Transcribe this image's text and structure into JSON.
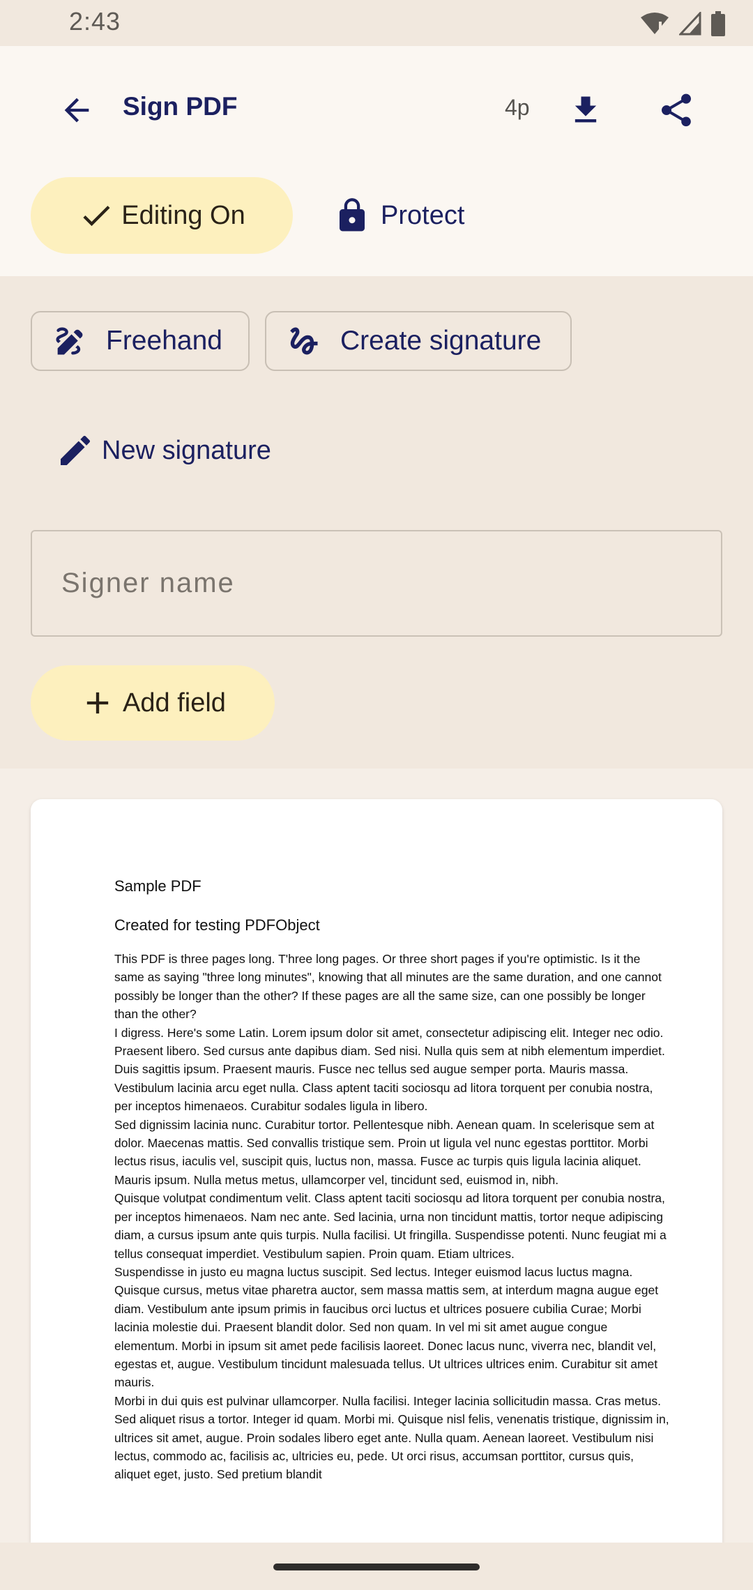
{
  "status_bar": {
    "time": "2:43"
  },
  "app_bar": {
    "title": "Sign PDF",
    "page_count": "4p",
    "icons": [
      "arrow-back-icon",
      "download-icon",
      "share-icon"
    ]
  },
  "mode_chips": {
    "editing_label": "Editing On",
    "protect_label": "Protect"
  },
  "signature_tools": {
    "freehand_label": "Freehand",
    "create_signature_label": "Create signature",
    "new_signature_label": "New signature"
  },
  "signer": {
    "placeholder": "Signer name",
    "value": ""
  },
  "add_field_label": "Add field",
  "pdf": {
    "title": "Sample PDF",
    "subtitle": "Created for testing PDFObject",
    "paragraphs": [
      "This PDF is three pages long. T'hree long pages. Or three short pages if you're optimistic. Is it the same as saying \"three long minutes\", knowing that all minutes are the same duration, and one cannot possibly be longer than the other? If these pages are all the same size, can one possibly be longer than the other?",
      "I digress. Here's some Latin. Lorem ipsum dolor sit amet, consectetur adipiscing elit. Integer nec odio. Praesent libero. Sed cursus ante dapibus diam. Sed nisi. Nulla quis sem at nibh elementum imperdiet. Duis sagittis ipsum. Praesent mauris. Fusce nec tellus sed augue semper porta. Mauris massa. Vestibulum lacinia arcu eget nulla. Class aptent taciti sociosqu ad litora torquent per conubia nostra, per inceptos himenaeos. Curabitur sodales ligula in libero.",
      "Sed dignissim lacinia nunc. Curabitur tortor. Pellentesque nibh. Aenean quam. In scelerisque sem at dolor. Maecenas mattis. Sed convallis tristique sem. Proin ut ligula vel nunc egestas porttitor. Morbi lectus risus, iaculis vel, suscipit quis, luctus non, massa. Fusce ac turpis quis ligula lacinia aliquet. Mauris ipsum. Nulla metus metus, ullamcorper vel, tincidunt sed, euismod in, nibh.",
      "Quisque volutpat condimentum velit. Class aptent taciti sociosqu ad litora torquent per conubia nostra, per inceptos himenaeos. Nam nec ante. Sed lacinia, urna non tincidunt mattis, tortor neque adipiscing diam, a cursus ipsum ante quis turpis. Nulla facilisi. Ut fringilla. Suspendisse potenti. Nunc feugiat mi a tellus consequat imperdiet. Vestibulum sapien. Proin quam. Etiam ultrices.",
      "Suspendisse in justo eu magna luctus suscipit. Sed lectus. Integer euismod lacus luctus magna. Quisque cursus, metus vitae pharetra auctor, sem massa mattis sem, at interdum magna augue eget diam. Vestibulum ante ipsum primis in faucibus orci luctus et ultrices posuere cubilia Curae; Morbi lacinia molestie dui. Praesent blandit dolor. Sed non quam. In vel mi sit amet augue congue elementum. Morbi in ipsum sit amet pede facilisis laoreet. Donec lacus nunc, viverra nec, blandit vel, egestas et, augue. Vestibulum tincidunt malesuada tellus. Ut ultrices ultrices enim. Curabitur sit amet mauris.",
      "Morbi in dui quis est pulvinar ullamcorper. Nulla facilisi. Integer lacinia sollicitudin massa. Cras metus. Sed aliquet risus a tortor. Integer id quam. Morbi mi. Quisque nisl felis, venenatis tristique, dignissim in, ultrices sit amet, augue. Proin sodales libero eget ante. Nulla quam. Aenean laoreet. Vestibulum nisi lectus, commodo ac, facilisis ac, ultricies eu, pede. Ut orci risus, accumsan porttitor, cursus quis, aliquet eget, justo. Sed pretium blandit"
    ]
  },
  "colors": {
    "background": "#F1E8DE",
    "app_bar": "#FBF7F2",
    "accent_text": "#1B2060",
    "chip_fill": "#FDF0BE"
  }
}
